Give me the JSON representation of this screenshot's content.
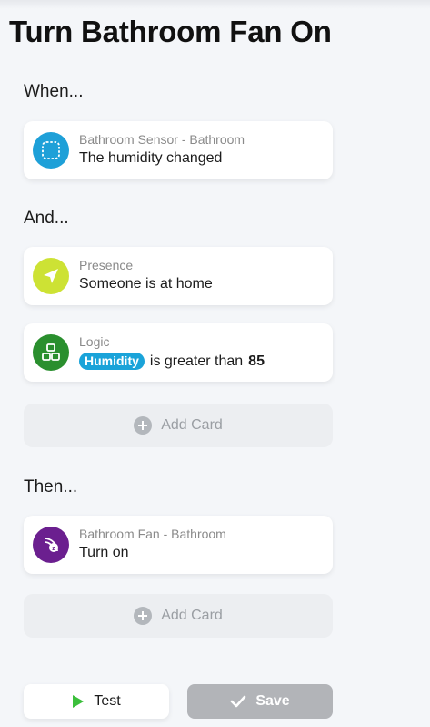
{
  "page": {
    "title": "Turn Bathroom Fan On"
  },
  "sections": {
    "when": "When...",
    "and": "And...",
    "then": "Then..."
  },
  "cards": {
    "trigger": {
      "subtitle": "Bathroom Sensor - Bathroom",
      "title": "The humidity changed",
      "icon": "sensor-icon",
      "color": "#1ea0d8"
    },
    "presence": {
      "subtitle": "Presence",
      "title": "Someone is at home",
      "icon": "location-arrow-icon",
      "color": "#cde234"
    },
    "logic": {
      "subtitle": "Logic",
      "token": "Humidity",
      "operator": "is greater than",
      "value": "85",
      "icon": "logic-blocks-icon",
      "color": "#2a8f2e"
    },
    "action": {
      "subtitle": "Bathroom Fan - Bathroom",
      "title": "Turn on",
      "icon": "zwave-fan-icon",
      "color": "#6b1f8f"
    }
  },
  "add_card_label": "Add Card",
  "buttons": {
    "test": "Test",
    "save": "Save"
  },
  "colors": {
    "accent": "#1aa3d9",
    "test_green": "#3bbf3b",
    "save_disabled": "#b2b4b8"
  }
}
